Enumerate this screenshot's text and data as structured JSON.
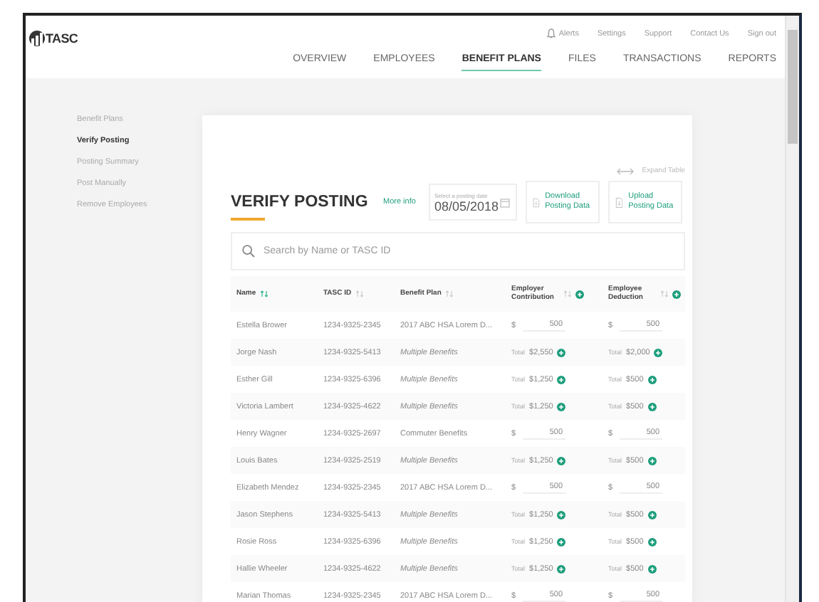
{
  "header": {
    "logo": "TASC",
    "utility_links": [
      {
        "label": "Alerts",
        "kind": "alerts"
      },
      {
        "label": "Settings",
        "kind": "plain"
      },
      {
        "label": "Support",
        "kind": "plain"
      },
      {
        "label": "Contact Us",
        "kind": "plain"
      },
      {
        "label": "Sign out",
        "kind": "plain"
      }
    ],
    "nav": [
      {
        "label": "OVERVIEW",
        "selected": false
      },
      {
        "label": "EMPLOYEES",
        "selected": false
      },
      {
        "label": "BENEFIT PLANS",
        "selected": true
      },
      {
        "label": "FILES",
        "selected": false
      },
      {
        "label": "TRANSACTIONS",
        "selected": false
      },
      {
        "label": "REPORTS",
        "selected": false
      }
    ]
  },
  "sidebar": {
    "items": [
      {
        "label": "Benefit Plans",
        "selected": false
      },
      {
        "label": "Verify Posting",
        "selected": true
      },
      {
        "label": "Posting Summary",
        "selected": false
      },
      {
        "label": "Post Manually",
        "selected": false
      },
      {
        "label": "Remove Employees",
        "selected": false
      }
    ]
  },
  "card": {
    "expand_label": "Expand Table",
    "title": "VERIFY POSTING",
    "more_info": "More info",
    "date_field": {
      "label": "Select a posting date",
      "value": "08/05/2018"
    },
    "actions": [
      {
        "label": "Download Posting Data"
      },
      {
        "label": "Upload Posting Data"
      }
    ],
    "search": {
      "placeholder": "Search by Name or TASC ID"
    },
    "table": {
      "columns": [
        {
          "label": "Name",
          "kind": "sort-active"
        },
        {
          "label": "TASC ID",
          "kind": "sort"
        },
        {
          "label": "Benefit Plan",
          "kind": "sort"
        },
        {
          "label": "Employer Contribution",
          "kind": "sort-add"
        },
        {
          "label": "Employee Deduction",
          "kind": "sort-add"
        }
      ],
      "rows": [
        {
          "name": "Estella Brower",
          "tasc_id": "1234-9325-2345",
          "plan": "2017 ABC HSA Lorem D...",
          "plan_italic": false,
          "kind": "input",
          "employer_currency": "$",
          "employer": "500",
          "employee_currency": "$",
          "employee": "500"
        },
        {
          "name": "Jorge Nash",
          "tasc_id": "1234-9325-5413",
          "plan": "Multiple Benefits",
          "plan_italic": true,
          "kind": "total",
          "employer_total_label": "Total",
          "employer": "$2,550",
          "employee_total_label": "Total",
          "employee": "$2,000"
        },
        {
          "name": "Esther Gill",
          "tasc_id": "1234-9325-6396",
          "plan": "Multiple Benefits",
          "plan_italic": true,
          "kind": "total",
          "employer_total_label": "Total",
          "employer": "$1,250",
          "employee_total_label": "Total",
          "employee": "$500"
        },
        {
          "name": "Victoria Lambert",
          "tasc_id": "1234-9325-4622",
          "plan": "Multiple Benefits",
          "plan_italic": true,
          "kind": "total",
          "employer_total_label": "Total",
          "employer": "$1,250",
          "employee_total_label": "Total",
          "employee": "$500"
        },
        {
          "name": "Henry Wagner",
          "tasc_id": "1234-9325-2697",
          "plan": "Commuter Benefits",
          "plan_italic": false,
          "kind": "input",
          "employer_currency": "$",
          "employer": "500",
          "employee_currency": "$",
          "employee": "500"
        },
        {
          "name": "Louis Bates",
          "tasc_id": "1234-9325-2519",
          "plan": "Multiple Benefits",
          "plan_italic": true,
          "kind": "total",
          "employer_total_label": "Total",
          "employer": "$1,250",
          "employee_total_label": "Total",
          "employee": "$500"
        },
        {
          "name": "Elizabeth Mendez",
          "tasc_id": "1234-9325-2345",
          "plan": "2017 ABC HSA Lorem D...",
          "plan_italic": false,
          "kind": "input",
          "employer_currency": "$",
          "employer": "500",
          "employee_currency": "$",
          "employee": "500"
        },
        {
          "name": "Jason Stephens",
          "tasc_id": "1234-9325-5413",
          "plan": "Multiple Benefits",
          "plan_italic": true,
          "kind": "total",
          "employer_total_label": "Total",
          "employer": "$1,250",
          "employee_total_label": "Total",
          "employee": "$500"
        },
        {
          "name": "Rosie Ross",
          "tasc_id": "1234-9325-6396",
          "plan": "Multiple Benefits",
          "plan_italic": true,
          "kind": "total",
          "employer_total_label": "Total",
          "employer": "$1,250",
          "employee_total_label": "Total",
          "employee": "$500"
        },
        {
          "name": "Hallie Wheeler",
          "tasc_id": "1234-9325-4622",
          "plan": "Multiple Benefits",
          "plan_italic": true,
          "kind": "total",
          "employer_total_label": "Total",
          "employer": "$1,250",
          "employee_total_label": "Total",
          "employee": "$500"
        },
        {
          "name": "Marian Thomas",
          "tasc_id": "1234-9325-2345",
          "plan": "2017 ABC HSA Lorem D...",
          "plan_italic": false,
          "kind": "input",
          "employer_currency": "$",
          "employer": "500",
          "employee_currency": "$",
          "employee": "500"
        }
      ]
    }
  }
}
